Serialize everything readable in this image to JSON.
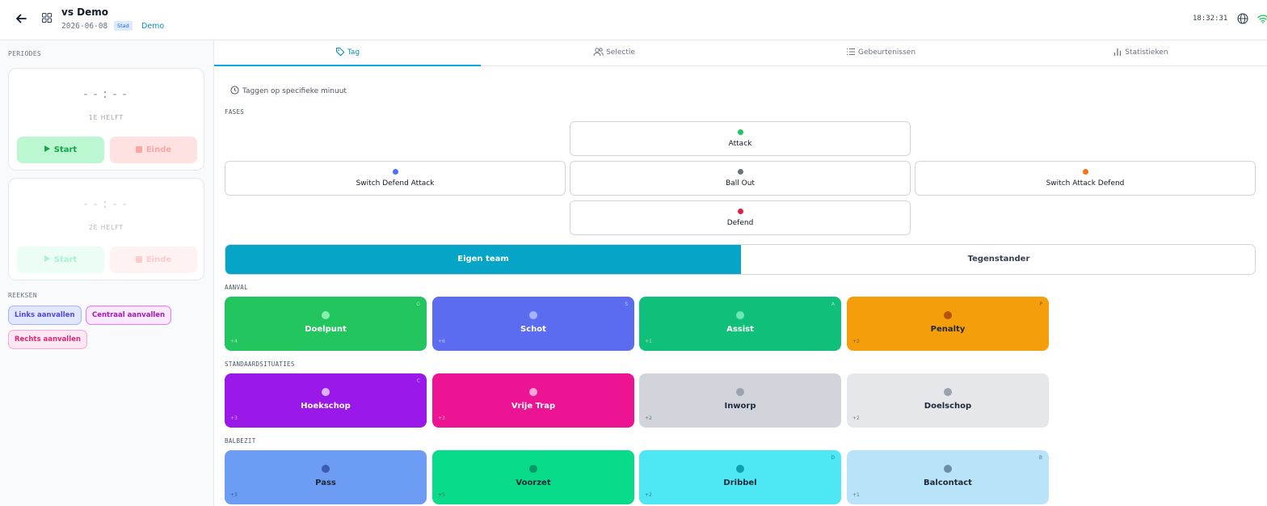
{
  "header": {
    "title": "vs Demo",
    "date": "2026-06-08",
    "badge": "Stad",
    "team": "Demo",
    "clock": "18:32:31",
    "icons": {
      "back": "back-arrow-icon",
      "grid": "grid-icon",
      "globe": "globe-icon",
      "wifi": "wifi-icon"
    }
  },
  "sidebar": {
    "periods_heading": "PERIODES",
    "periods": [
      {
        "time": "--:--",
        "label": "1E HELFT",
        "start": "Start",
        "end": "Einde"
      },
      {
        "time": "--:--",
        "label": "2E HELFT",
        "start": "Start",
        "end": "Einde"
      }
    ],
    "series_heading": "REEKSEN",
    "series": [
      {
        "label": "Links aanvallen",
        "color": "#6366f1"
      },
      {
        "label": "Centraal aanvallen",
        "color": "#a21caf"
      },
      {
        "label": "Rechts aanvallen",
        "color": "#db2777"
      }
    ]
  },
  "tabs": [
    {
      "label": "Tag",
      "icon": "tag-icon"
    },
    {
      "label": "Selectie",
      "icon": "users-icon"
    },
    {
      "label": "Gebeurtenissen",
      "icon": "list-icon"
    },
    {
      "label": "Statistieken",
      "icon": "bar-chart-icon"
    }
  ],
  "minute_link": "Taggen op specifieke minuut",
  "phases_heading": "FASES",
  "phases": {
    "attack": {
      "label": "Attack",
      "color": "#22c55e"
    },
    "switch_defend_attack": {
      "label": "Switch Defend Attack",
      "color": "#4f6ef7"
    },
    "ball_out": {
      "label": "Ball Out",
      "color": "#6b7280"
    },
    "switch_attack_defend": {
      "label": "Switch Attack Defend",
      "color": "#f97316"
    },
    "defend": {
      "label": "Defend",
      "color": "#e11d48"
    }
  },
  "team_toggle": {
    "own": "Eigen team",
    "opponent": "Tegenstander"
  },
  "sections": [
    {
      "heading": "AANVAL",
      "events": [
        {
          "label": "Doelpunt",
          "key": "G",
          "points": "+4",
          "bg": "#22c55e",
          "fg": "#ffffff",
          "dot": "#86efac"
        },
        {
          "label": "Schot",
          "key": "S",
          "points": "+6",
          "bg": "#5b6cf0",
          "fg": "#ffffff",
          "dot": "#a5b4fc"
        },
        {
          "label": "Assist",
          "key": "A",
          "points": "+1",
          "bg": "#10c07a",
          "fg": "#ffffff",
          "dot": "#6ee7b7"
        },
        {
          "label": "Penalty",
          "key": "P",
          "points": "+2",
          "bg": "#f59e0b",
          "fg": "#1f2937",
          "dot": "#b45309"
        }
      ]
    },
    {
      "heading": "STANDAARDSITUATIES",
      "events": [
        {
          "label": "Hoekschop",
          "key": "C",
          "points": "+3",
          "bg": "#9b19e8",
          "fg": "#ffffff",
          "dot": "#d8b4fe"
        },
        {
          "label": "Vrije Trap",
          "key": "",
          "points": "+3",
          "bg": "#ec1493",
          "fg": "#ffffff",
          "dot": "#f9a8d4"
        },
        {
          "label": "Inworp",
          "key": "",
          "points": "+2",
          "bg": "#d1d5db",
          "fg": "#1f2937",
          "dot": "#9ca3af"
        },
        {
          "label": "Doelschop",
          "key": "",
          "points": "+2",
          "bg": "#e5e7eb",
          "fg": "#1f2937",
          "dot": "#9ca3af"
        }
      ]
    },
    {
      "heading": "BALBEZIT",
      "events": [
        {
          "label": "Pass",
          "key": "",
          "points": "+3",
          "bg": "#6d9cf5",
          "fg": "#1f2937",
          "dot": "#3b5bb0"
        },
        {
          "label": "Voorzet",
          "key": "",
          "points": "+5",
          "bg": "#08db8a",
          "fg": "#1f2937",
          "dot": "#059669"
        },
        {
          "label": "Dribbel",
          "key": "D",
          "points": "+2",
          "bg": "#4ee8f5",
          "fg": "#1f2937",
          "dot": "#0e9fb0"
        },
        {
          "label": "Balcontact",
          "key": "B",
          "points": "+1",
          "bg": "#b9e3f9",
          "fg": "#1f2937",
          "dot": "#6b8fa8"
        }
      ]
    }
  ]
}
